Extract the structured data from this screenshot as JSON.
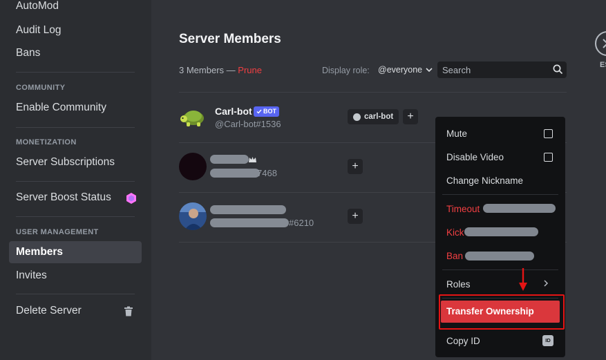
{
  "sidebar": {
    "items_top": [
      {
        "label": "AutoMod"
      },
      {
        "label": "Audit Log"
      },
      {
        "label": "Bans"
      }
    ],
    "community_header": "COMMUNITY",
    "enable_community": "Enable Community",
    "monetization_header": "MONETIZATION",
    "server_subscriptions": "Server Subscriptions",
    "server_boost_status": "Server Boost Status",
    "user_management_header": "USER MANAGEMENT",
    "members": "Members",
    "invites": "Invites",
    "delete_server": "Delete Server"
  },
  "main": {
    "title": "Server Members",
    "member_count": "3 Members",
    "dash": "—",
    "prune": "Prune",
    "display_role_label": "Display role:",
    "display_role_value": "@everyone",
    "search_placeholder": "Search",
    "members": [
      {
        "name": "Carl-bot",
        "badge": "BOT",
        "tag": "@Carl-bot#1536",
        "role": "carl-bot"
      },
      {
        "name": "",
        "tag_suffix": "7468"
      },
      {
        "name": "",
        "tag_suffix": "#6210"
      }
    ]
  },
  "context_menu": {
    "mute": "Mute",
    "disable_video": "Disable Video",
    "change_nickname": "Change Nickname",
    "timeout": "Timeout",
    "kick": "Kick",
    "ban": "Ban",
    "roles": "Roles",
    "transfer_ownership": "Transfer Ownership",
    "copy_id": "Copy ID",
    "id_badge": "ID"
  },
  "close": {
    "label": "ES"
  },
  "colors": {
    "accent": "#5865f2",
    "danger": "#f23f42",
    "highlight_outline": "#e51414",
    "transfer_bg": "#da373c"
  }
}
